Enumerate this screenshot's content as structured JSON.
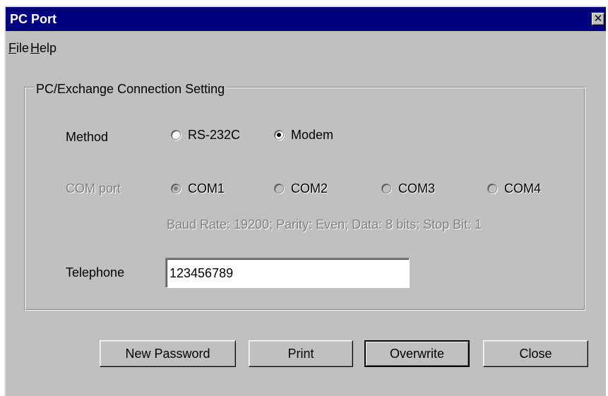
{
  "window": {
    "title": "PC Port",
    "close_glyph": "✕"
  },
  "menu": {
    "items": [
      {
        "underline": "F",
        "rest": "ile"
      },
      {
        "underline": "H",
        "rest": "elp"
      }
    ]
  },
  "group": {
    "title": "PC/Exchange Connection Setting"
  },
  "method": {
    "label": "Method",
    "options": [
      "RS-232C",
      "Modem"
    ],
    "selected": "Modem"
  },
  "com_port": {
    "label": "COM port",
    "options": [
      "COM1",
      "COM2",
      "COM3",
      "COM4"
    ],
    "selected": "COM1",
    "enabled": false,
    "info": "Baud Rate: 19200; Parity: Even; Data: 8 bits; Stop Bit: 1"
  },
  "telephone": {
    "label": "Telephone",
    "value": "123456789"
  },
  "buttons": {
    "new_password": "New Password",
    "print": "Print",
    "overwrite": "Overwrite",
    "close": "Close"
  }
}
